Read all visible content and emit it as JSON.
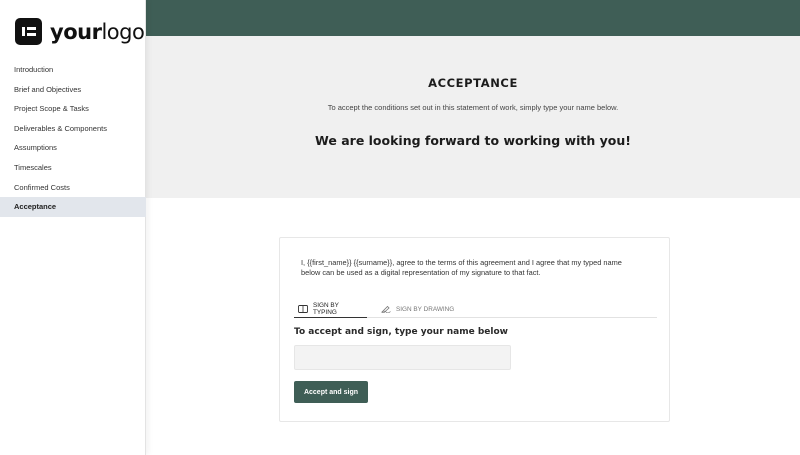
{
  "logo": {
    "prefix": "your",
    "suffix": "logo"
  },
  "sidebar": {
    "items": [
      {
        "label": "Introduction",
        "active": false
      },
      {
        "label": "Brief and Objectives",
        "active": false
      },
      {
        "label": "Project Scope & Tasks",
        "active": false
      },
      {
        "label": "Deliverables & Components",
        "active": false
      },
      {
        "label": "Assumptions",
        "active": false
      },
      {
        "label": "Timescales",
        "active": false
      },
      {
        "label": "Confirmed Costs",
        "active": false
      },
      {
        "label": "Acceptance",
        "active": true
      }
    ]
  },
  "hero": {
    "title": "ACCEPTANCE",
    "subtitle": "To accept the conditions set out in this statement of work, simply type your name below.",
    "tagline": "We are looking forward to working with you!"
  },
  "card": {
    "agreement": "I, {{first_name}} {{surname}}, agree to the terms of this agreement and I agree that my typed name below can be used as a digital representation of my signature to that fact.",
    "tabs": [
      {
        "label": "SIGN BY TYPING",
        "icon": "keyboard-icon",
        "active": true
      },
      {
        "label": "SIGN BY DRAWING",
        "icon": "pen-icon",
        "active": false
      }
    ],
    "heading": "To accept and sign, type your name below",
    "input_value": "",
    "input_placeholder": "",
    "button_label": "Accept and sign"
  },
  "colors": {
    "accent": "#3f5e56",
    "hero_bg": "#f0f0f0",
    "active_nav_bg": "#e2e6ec"
  }
}
